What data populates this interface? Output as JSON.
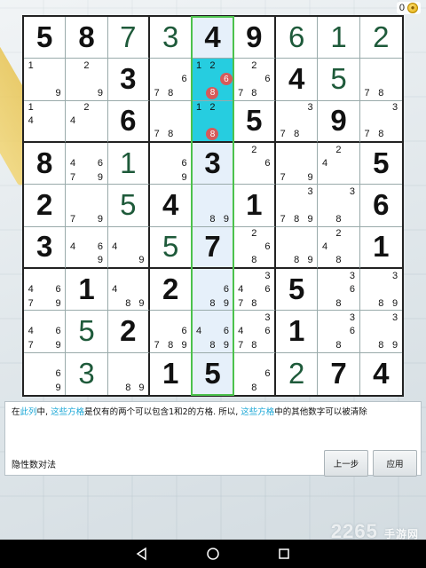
{
  "coins": {
    "count": "0"
  },
  "board": {
    "grid": [
      [
        {
          "v": "5",
          "t": "g"
        },
        {
          "v": "8",
          "t": "g"
        },
        {
          "v": "7",
          "t": "e"
        },
        {
          "v": "3",
          "t": "e"
        },
        {
          "v": "4",
          "t": "g"
        },
        {
          "v": "9",
          "t": "g"
        },
        {
          "v": "6",
          "t": "e"
        },
        {
          "v": "1",
          "t": "e"
        },
        {
          "v": "2",
          "t": "e"
        }
      ],
      [
        {
          "n": [
            1,
            9
          ]
        },
        {
          "n": [
            2,
            9
          ]
        },
        {
          "v": "3",
          "t": "g"
        },
        {
          "n": [
            6,
            7,
            8
          ]
        },
        {
          "n": [
            1,
            2
          ],
          "rm": [
            6,
            8
          ]
        },
        {
          "n": [
            2,
            6,
            7,
            8
          ]
        },
        {
          "v": "4",
          "t": "g"
        },
        {
          "v": "5",
          "t": "e"
        },
        {
          "n": [
            7,
            8
          ]
        }
      ],
      [
        {
          "n": [
            1,
            4
          ]
        },
        {
          "n": [
            2,
            4
          ]
        },
        {
          "v": "6",
          "t": "g"
        },
        {
          "n": [
            7,
            8
          ]
        },
        {
          "n": [
            1,
            2
          ],
          "rm": [
            8
          ]
        },
        {
          "v": "5",
          "t": "g"
        },
        {
          "n": [
            3,
            7,
            8
          ]
        },
        {
          "v": "9",
          "t": "g"
        },
        {
          "n": [
            3,
            7,
            8
          ]
        }
      ],
      [
        {
          "v": "8",
          "t": "g"
        },
        {
          "n": [
            4,
            6,
            7,
            9
          ]
        },
        {
          "v": "1",
          "t": "e"
        },
        {
          "n": [
            6,
            9
          ]
        },
        {
          "v": "3",
          "t": "g"
        },
        {
          "n": [
            2,
            6
          ]
        },
        {
          "n": [
            7,
            9
          ]
        },
        {
          "n": [
            2,
            4
          ]
        },
        {
          "v": "5",
          "t": "g"
        }
      ],
      [
        {
          "v": "2",
          "t": "g"
        },
        {
          "n": [
            7,
            9
          ]
        },
        {
          "v": "5",
          "t": "e"
        },
        {
          "v": "4",
          "t": "g"
        },
        {
          "n": [
            8,
            9
          ]
        },
        {
          "v": "1",
          "t": "g"
        },
        {
          "n": [
            3,
            7,
            8,
            9
          ]
        },
        {
          "n": [
            3,
            8
          ]
        },
        {
          "v": "6",
          "t": "g"
        }
      ],
      [
        {
          "v": "3",
          "t": "g"
        },
        {
          "n": [
            4,
            6,
            9
          ]
        },
        {
          "n": [
            4,
            9
          ]
        },
        {
          "v": "5",
          "t": "e"
        },
        {
          "v": "7",
          "t": "g"
        },
        {
          "n": [
            2,
            6,
            8
          ]
        },
        {
          "n": [
            8,
            9
          ]
        },
        {
          "n": [
            2,
            4,
            8
          ]
        },
        {
          "v": "1",
          "t": "g"
        }
      ],
      [
        {
          "n": [
            4,
            6,
            7,
            9
          ]
        },
        {
          "v": "1",
          "t": "g"
        },
        {
          "n": [
            4,
            8,
            9
          ]
        },
        {
          "v": "2",
          "t": "g"
        },
        {
          "n": [
            6,
            8,
            9
          ]
        },
        {
          "n": [
            3,
            4,
            6,
            7,
            8
          ]
        },
        {
          "v": "5",
          "t": "g"
        },
        {
          "n": [
            3,
            6,
            8
          ]
        },
        {
          "n": [
            3,
            8,
            9
          ]
        }
      ],
      [
        {
          "n": [
            4,
            6,
            7,
            9
          ]
        },
        {
          "v": "5",
          "t": "e"
        },
        {
          "v": "2",
          "t": "g"
        },
        {
          "n": [
            6,
            7,
            8,
            9
          ]
        },
        {
          "n": [
            4,
            6,
            8,
            9
          ]
        },
        {
          "n": [
            3,
            4,
            6,
            7,
            8
          ]
        },
        {
          "v": "1",
          "t": "g"
        },
        {
          "n": [
            3,
            6,
            8
          ]
        },
        {
          "n": [
            3,
            8,
            9
          ]
        }
      ],
      [
        {
          "n": [
            6,
            9
          ]
        },
        {
          "v": "3",
          "t": "e"
        },
        {
          "n": [
            8,
            9
          ]
        },
        {
          "v": "1",
          "t": "g"
        },
        {
          "v": "5",
          "t": "g"
        },
        {
          "n": [
            6,
            8
          ]
        },
        {
          "v": "2",
          "t": "e"
        },
        {
          "v": "7",
          "t": "g"
        },
        {
          "v": "4",
          "t": "g"
        }
      ]
    ],
    "highlight_col": 4,
    "highlight_cells": [
      [
        1,
        4
      ],
      [
        2,
        4
      ]
    ]
  },
  "hint": {
    "segments": [
      {
        "text": "在",
        "accent": false
      },
      {
        "text": "此列",
        "accent": true
      },
      {
        "text": "中, ",
        "accent": false
      },
      {
        "text": "这些方格",
        "accent": true
      },
      {
        "text": "是仅有的两个可以包含1和2的方格. 所以, ",
        "accent": false
      },
      {
        "text": "这些方格",
        "accent": true
      },
      {
        "text": "中的其他数字可以被清除",
        "accent": false
      }
    ],
    "technique": "隐性数对法",
    "prev_label": "上一步",
    "apply_label": "应用"
  },
  "watermark": {
    "main": "2265",
    "sub": "手游网"
  },
  "colors": {
    "accent": "#1aa7d6",
    "highlight": "#26cde0",
    "outline": "#4cc24c",
    "removed": "#d65a5a"
  }
}
